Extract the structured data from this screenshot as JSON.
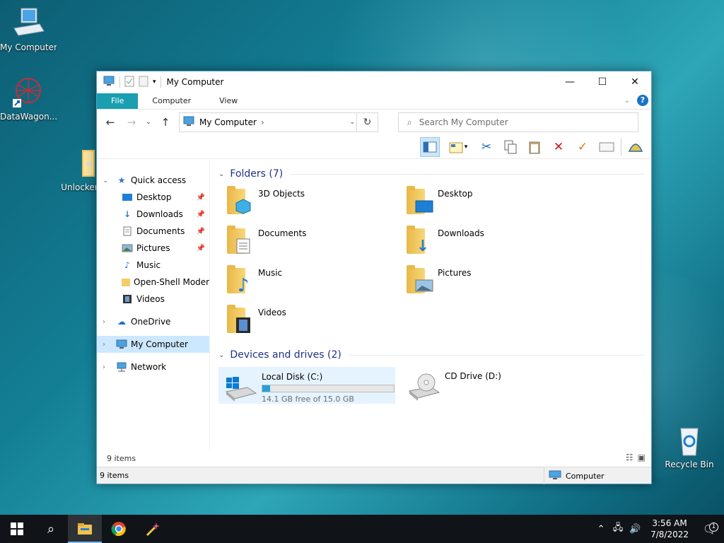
{
  "desktop": {
    "icons": [
      {
        "label": "My Computer",
        "icon": "computer-icon"
      },
      {
        "label": "DataWagon...",
        "icon": "datawagon-icon"
      },
      {
        "label": "UnlockerP",
        "icon": "folder-icon"
      },
      {
        "label": "Recycle Bin",
        "icon": "recycle-bin-icon"
      }
    ]
  },
  "window": {
    "title": "My Computer",
    "controls": {
      "minimize": "—",
      "maximize": "☐",
      "close": "✕"
    },
    "ribbon_tabs": [
      "File",
      "Computer",
      "View"
    ],
    "address": {
      "path": "My Computer",
      "separator": "›"
    },
    "search": {
      "placeholder": "Search My Computer"
    },
    "nav": {
      "quick_access": "Quick access",
      "quick_items": [
        "Desktop",
        "Downloads",
        "Documents",
        "Pictures",
        "Music",
        "Open-Shell Modern",
        "Videos"
      ],
      "onedrive": "OneDrive",
      "my_computer": "My Computer",
      "network": "Network"
    },
    "content": {
      "folders_header": "Folders (7)",
      "folders": [
        "3D Objects",
        "Desktop",
        "Documents",
        "Downloads",
        "Music",
        "Pictures",
        "Videos"
      ],
      "devices_header": "Devices and drives (2)",
      "drives": [
        {
          "name": "Local Disk (C:)",
          "free": "14.1 GB free of 15.0 GB",
          "used_fraction": 0.06
        },
        {
          "name": "CD Drive (D:)"
        }
      ]
    },
    "status": {
      "items": "9 items",
      "items2": "9 items",
      "zone": "Computer"
    }
  },
  "taskbar": {
    "time": "3:56 AM",
    "date": "7/8/2022",
    "notification_count": "1"
  }
}
